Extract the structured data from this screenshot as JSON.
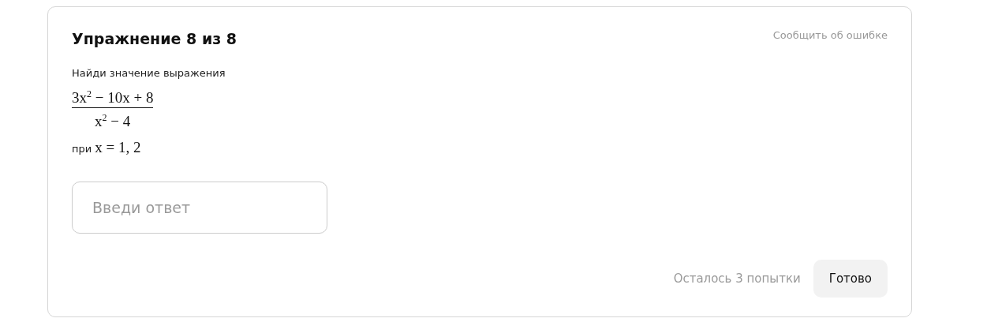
{
  "exercise": {
    "title": "Упражнение 8 из 8",
    "report_link": "Сообщить об ошибке",
    "prompt": "Найди значение выражения",
    "fraction": {
      "numerator": "3x$^{2}$ − 10x + 8",
      "denominator": "x$^{2}$ − 4"
    },
    "condition": {
      "label": "при",
      "value": "x = 1, 2"
    },
    "answer": {
      "placeholder": "Введи ответ"
    },
    "attempts_left": "Осталось 3 попытки",
    "submit_button": "Готово"
  }
}
